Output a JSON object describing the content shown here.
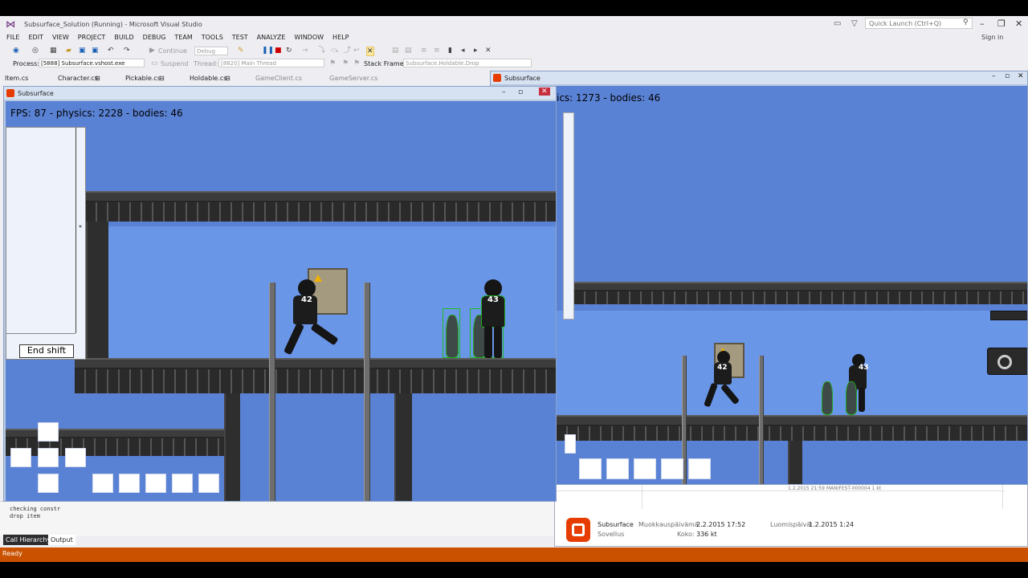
{
  "vs": {
    "title": "Subsurface_Solution (Running) - Microsoft Visual Studio",
    "quick_launch_placeholder": "Quick Launch (Ctrl+Q)",
    "sign_in": "Sign in",
    "menu": [
      "FILE",
      "EDIT",
      "VIEW",
      "PROJECT",
      "BUILD",
      "DEBUG",
      "TEAM",
      "TOOLS",
      "TEST",
      "ANALYZE",
      "WINDOW",
      "HELP"
    ],
    "toolbar": {
      "continue_label": "Continue",
      "config_value": "Debug",
      "process_label": "Process:",
      "process_value": "[5888] Subsurface.vshost.exe",
      "suspend_label": "Suspend",
      "thread_label": "Thread:",
      "thread_value": "[8820] Main Thread",
      "stackframe_label": "Stack Frame:",
      "stackframe_value": "Subsurface.Holdable.Drop"
    },
    "tabs": [
      "Item.cs",
      "Character.cs",
      "Pickable.cs",
      "Holdable.cs",
      "GameClient.cs",
      "GameServer.cs"
    ],
    "output_lines": [
      "checking constr",
      "drop item"
    ],
    "panel_tabs": [
      "Call Hierarchy",
      "Output"
    ],
    "status": "Ready"
  },
  "explorer": {
    "row_text": "1.2.2015 21:59          MANIFEST-000004          1 kt",
    "name": "Subsurface",
    "type": "Sovellus",
    "modified_label": "Muokkauspäivämä...",
    "modified_value": "2.2.2015 17:52",
    "size_label": "Koko:",
    "size_value": "336 kt",
    "created_label": "Luomispäivä:",
    "created_value": "1.2.2015 1:24"
  },
  "game_left": {
    "title": "Subsurface",
    "hud": "FPS: 87 - physics: 2228 - bodies: 46",
    "end_shift": "End shift",
    "player_hp": "42",
    "enemy_hp": "43"
  },
  "game_right": {
    "title": "Subsurface",
    "hud": "ics: 1273 - bodies: 46",
    "player_hp": "42",
    "enemy_hp": "43"
  },
  "icons": [
    "vs-logo-icon",
    "filter-icon",
    "feedback-icon",
    "search-icon",
    "minimize-icon",
    "maximize-icon",
    "close-icon",
    "pause-icon",
    "stop-icon",
    "restart-icon"
  ]
}
